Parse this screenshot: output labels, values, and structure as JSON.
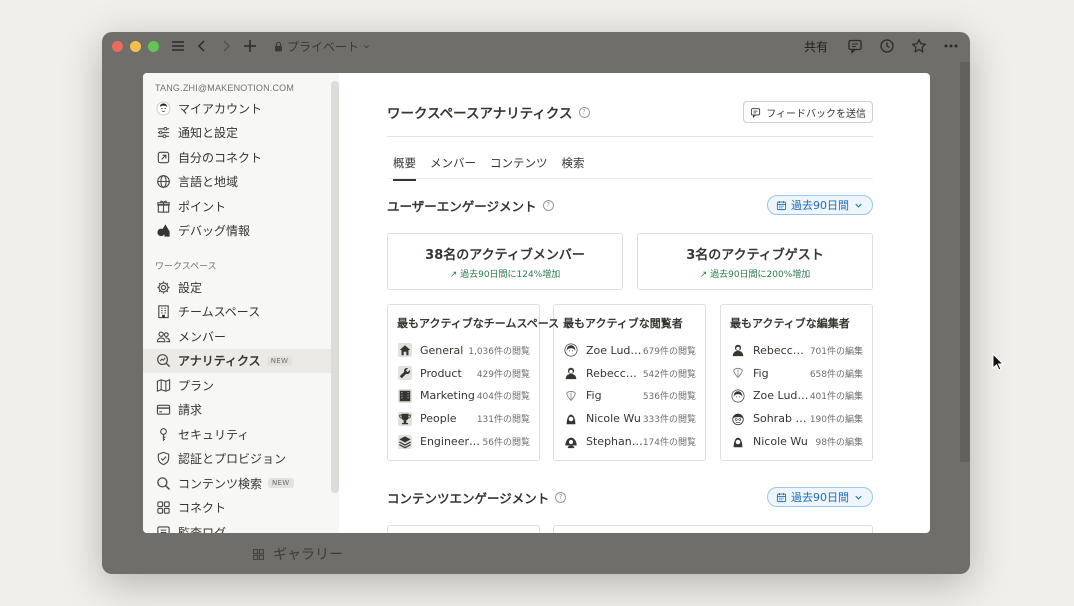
{
  "window": {
    "breadcrumb": "プライベート",
    "share_label": "共有",
    "background_item": "ギャラリー"
  },
  "sidebar": {
    "email": "TANG.ZHI@MAKENOTION.COM",
    "account_items": [
      {
        "label": "マイアカウント",
        "icon": "avatar-icon"
      },
      {
        "label": "通知と設定",
        "icon": "sliders-icon"
      },
      {
        "label": "自分のコネクト",
        "icon": "external-link-icon"
      },
      {
        "label": "言語と地域",
        "icon": "globe-icon"
      },
      {
        "label": "ポイント",
        "icon": "gift-icon"
      },
      {
        "label": "デバッグ情報",
        "icon": "shapes-icon"
      }
    ],
    "workspace_section": "ワークスペース",
    "workspace_items": [
      {
        "label": "設定",
        "icon": "gear-icon"
      },
      {
        "label": "チームスペース",
        "icon": "building-icon"
      },
      {
        "label": "メンバー",
        "icon": "people-icon"
      },
      {
        "label": "アナリティクス",
        "icon": "analytics-icon",
        "badge": "NEW",
        "active": true
      },
      {
        "label": "プラン",
        "icon": "map-icon"
      },
      {
        "label": "請求",
        "icon": "credit-card-icon"
      },
      {
        "label": "セキュリティ",
        "icon": "key-icon"
      },
      {
        "label": "認証とプロビジョン",
        "icon": "shield-icon"
      },
      {
        "label": "コンテンツ検索",
        "icon": "search-icon",
        "badge": "NEW"
      },
      {
        "label": "コネクト",
        "icon": "grid-icon"
      },
      {
        "label": "監査ログ",
        "icon": "list-icon"
      }
    ]
  },
  "main": {
    "title": "ワークスペースアナリティクス",
    "feedback_label": "フィードバックを送信",
    "tabs": [
      {
        "label": "概要",
        "active": true
      },
      {
        "label": "メンバー"
      },
      {
        "label": "コンテンツ"
      },
      {
        "label": "検索"
      }
    ],
    "engagement": {
      "title": "ユーザーエンゲージメント",
      "range_label": "過去90日間",
      "stats": [
        {
          "value": "38名のアクティブメンバー",
          "change": "過去90日間に124%増加"
        },
        {
          "value": "3名のアクティブゲスト",
          "change": "過去90日間に200%増加"
        }
      ],
      "lists": [
        {
          "title": "最もアクティブなチームスペース",
          "rows": [
            {
              "name": "General",
              "count": "1,036件の閲覧",
              "icon": "home-icon"
            },
            {
              "name": "Product",
              "count": "429件の閲覧",
              "icon": "wrench-icon"
            },
            {
              "name": "Marketing",
              "count": "404件の閲覧",
              "icon": "film-icon"
            },
            {
              "name": "People",
              "count": "131件の閲覧",
              "icon": "trophy-icon"
            },
            {
              "name": "Engineering",
              "count": "56件の閲覧",
              "icon": "layers-icon"
            }
          ]
        },
        {
          "title": "最もアクティブな閲覧者",
          "rows": [
            {
              "name": "Zoe Ludwig",
              "count": "679件の閲覧"
            },
            {
              "name": "Rebecca Lee",
              "count": "542件の閲覧"
            },
            {
              "name": "Fig",
              "count": "536件の閲覧"
            },
            {
              "name": "Nicole Wu",
              "count": "333件の閲覧"
            },
            {
              "name": "Stephanie Li",
              "count": "174件の閲覧"
            }
          ]
        },
        {
          "title": "最もアクティブな編集者",
          "rows": [
            {
              "name": "Rebecca Lee",
              "count": "701件の編集"
            },
            {
              "name": "Fig",
              "count": "658件の編集"
            },
            {
              "name": "Zoe Ludwig",
              "count": "401件の編集"
            },
            {
              "name": "Sohrab Amini",
              "count": "190件の編集"
            },
            {
              "name": "Nicole Wu",
              "count": "98件の編集"
            }
          ]
        }
      ]
    },
    "content_engagement": {
      "title": "コンテンツエンゲージメント",
      "range_label": "過去90日間"
    }
  }
}
